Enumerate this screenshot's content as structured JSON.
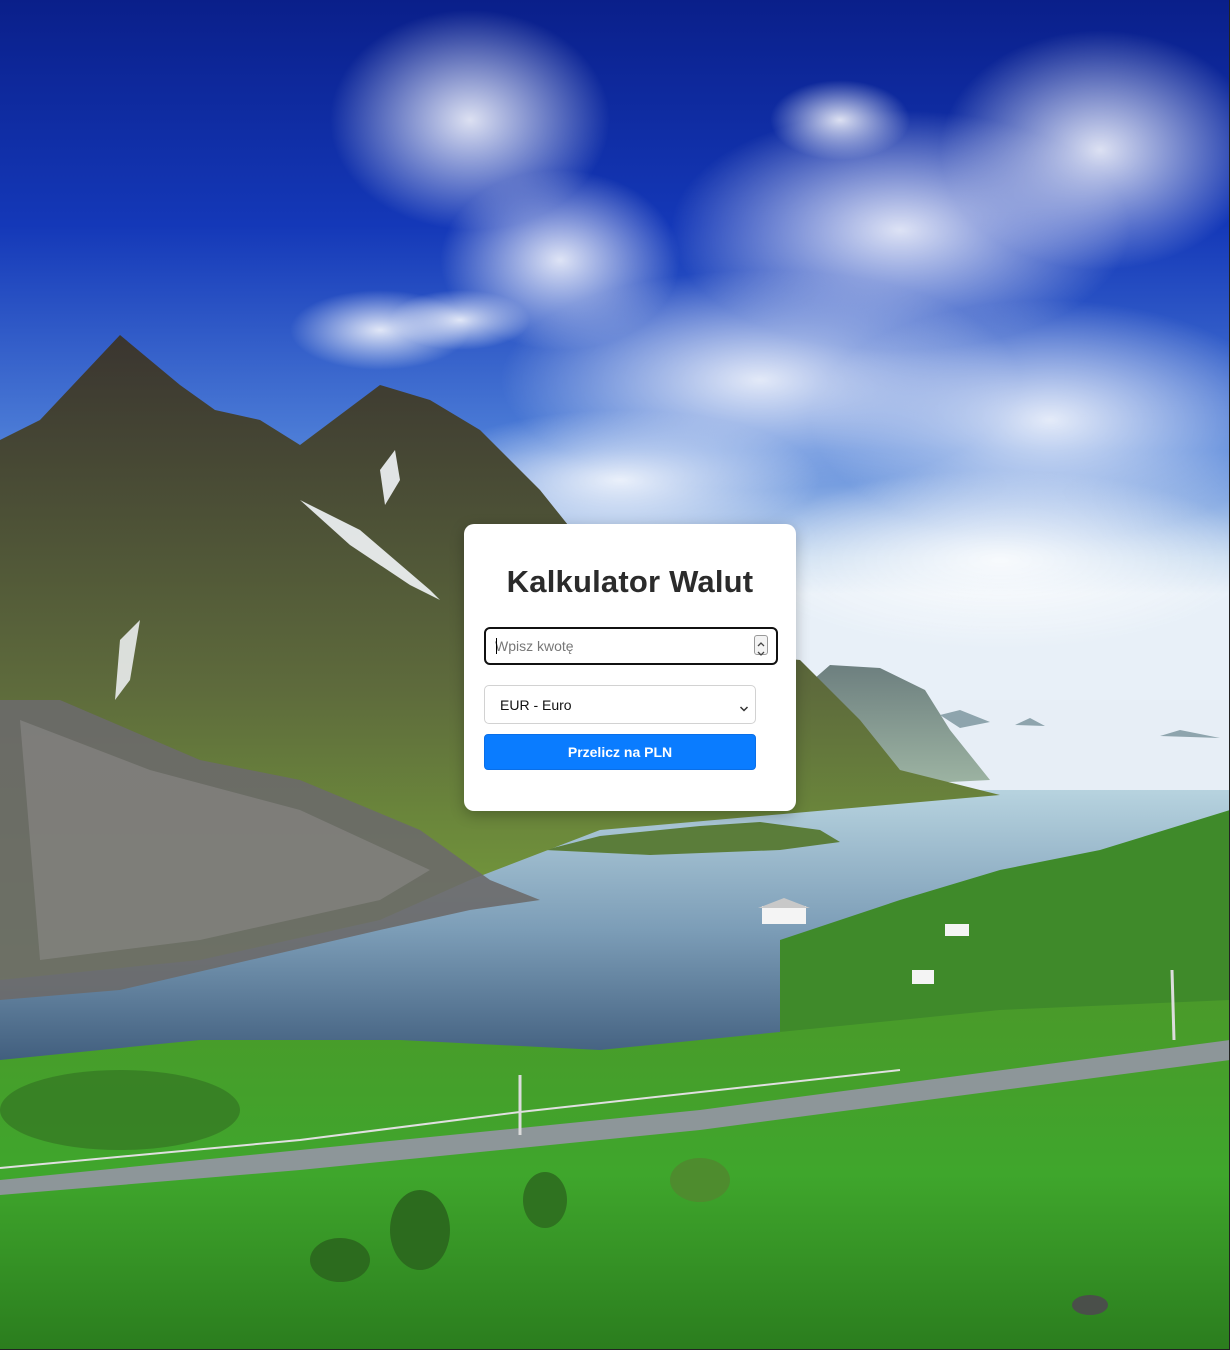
{
  "calculator": {
    "title": "Kalkulator Walut",
    "amount_placeholder": "Wpisz kwotę",
    "amount_value": "",
    "selected_currency": "EUR - Euro",
    "convert_label": "Przelicz na PLN",
    "accent_color": "#0a7cff"
  },
  "background": {
    "description_icon": "landscape-photo"
  }
}
